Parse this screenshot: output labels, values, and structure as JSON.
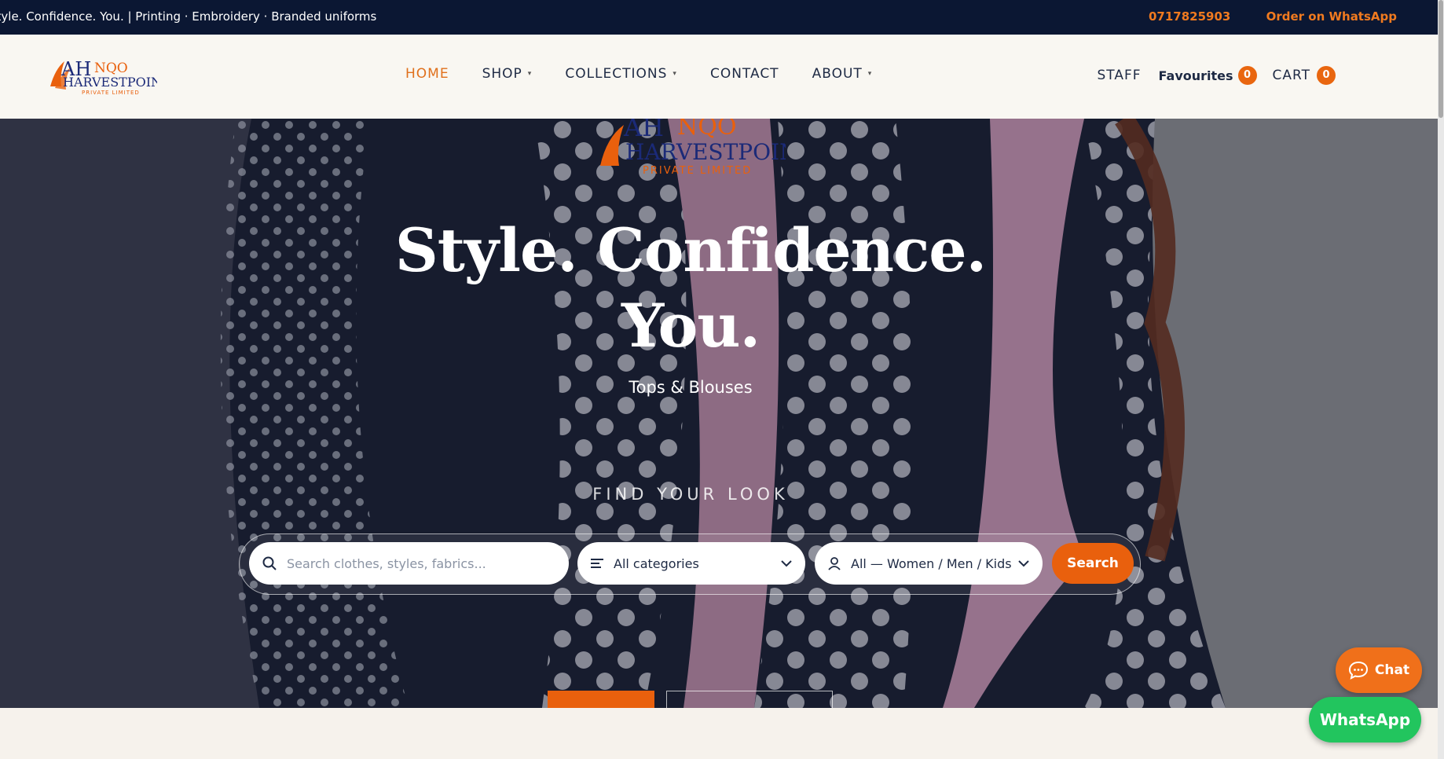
{
  "topbar": {
    "ticker": "Style. Confidence. You.  |  Printing · Embroidery · Branded uniforms",
    "phone": "0717825903",
    "whatsapp_order": "Order on WhatsApp"
  },
  "brand": {
    "name_top": "NQO",
    "name_main": "HARVESTPOINT",
    "name_sub": "PRIVATE LIMITED",
    "colors": {
      "orange": "#e9600d",
      "navy": "#1b2a78"
    }
  },
  "nav": {
    "items": [
      {
        "label": "HOME",
        "active": true,
        "dropdown": false
      },
      {
        "label": "SHOP",
        "active": false,
        "dropdown": true
      },
      {
        "label": "COLLECTIONS",
        "active": false,
        "dropdown": true
      },
      {
        "label": "CONTACT",
        "active": false,
        "dropdown": false
      },
      {
        "label": "ABOUT",
        "active": false,
        "dropdown": true
      }
    ]
  },
  "header_right": {
    "staff": "STAFF",
    "favourites": "Favourites",
    "favourites_count": "0",
    "cart": "CART",
    "cart_count": "0"
  },
  "hero": {
    "title_line1": "Style. Confidence.",
    "title_line2": "You.",
    "subtitle": "Tops & Blouses",
    "find_label": "FIND YOUR LOOK"
  },
  "search": {
    "placeholder": "Search clothes, styles, fabrics...",
    "category_value": "All categories",
    "audience_value": "All — Women / Men / Kids",
    "button": "Search"
  },
  "floating": {
    "chat": "Chat",
    "whatsapp": "WhatsApp"
  }
}
